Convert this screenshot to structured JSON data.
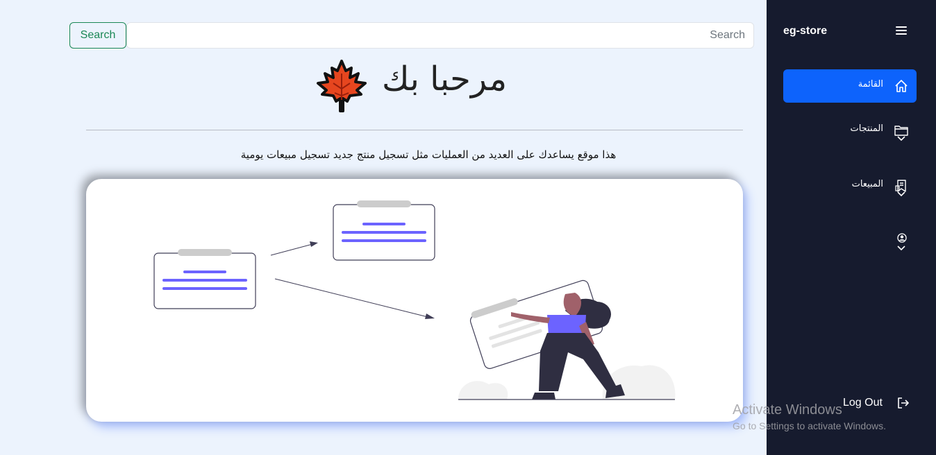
{
  "sidebar": {
    "brand": "eg-store",
    "menu_icon": "hamburger-icon",
    "items": [
      {
        "label": "القائمة",
        "icon": "home-icon",
        "active": true,
        "has_submenu": false
      },
      {
        "label": "المنتجات",
        "icon": "folder-icon",
        "active": false,
        "has_submenu": true
      },
      {
        "label": "المبيعات",
        "icon": "receipt-icon",
        "active": false,
        "has_submenu": true
      },
      {
        "label": "",
        "icon": "user-circle-icon",
        "active": false,
        "has_submenu": true
      }
    ],
    "logout_label": "Log Out",
    "logout_icon": "logout-icon"
  },
  "search": {
    "button_label": "Search",
    "placeholder": "Search",
    "value": ""
  },
  "main": {
    "welcome": "مرحبا بك",
    "welcome_icon": "maple-leaf-icon",
    "description": "هذا موقع يساعدك على العديد من العمليات مثل تسجيل منتج جديد تسجيل مبيعات يومية",
    "illustration": "woman-with-documents-illustration"
  },
  "watermark": {
    "title": "Activate Windows",
    "subtitle": "Go to Settings to activate Windows."
  },
  "colors": {
    "sidebar_bg": "#161b2e",
    "active_item": "#0d63fc",
    "search_green": "#1a8754",
    "page_bg": "#ecf3fd",
    "accent_purple": "#6c63ff"
  }
}
